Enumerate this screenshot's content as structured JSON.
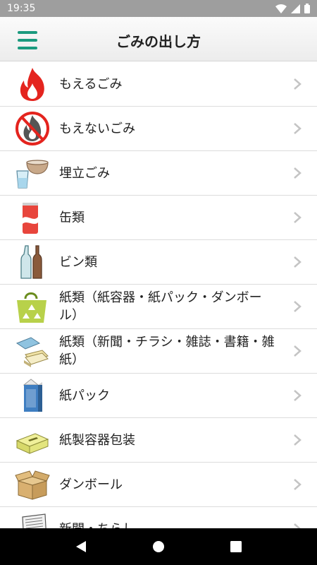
{
  "status": {
    "time": "19:35"
  },
  "header": {
    "title": "ごみの出し方"
  },
  "items": [
    {
      "label": "もえるごみ",
      "icon": "fire-icon"
    },
    {
      "label": "もえないごみ",
      "icon": "no-fire-icon"
    },
    {
      "label": "埋立ごみ",
      "icon": "bowl-glass-icon"
    },
    {
      "label": "缶類",
      "icon": "can-icon"
    },
    {
      "label": "ビン類",
      "icon": "bottles-icon"
    },
    {
      "label": "紙類（紙容器・紙パック・ダンボール）",
      "icon": "recycle-bag-icon"
    },
    {
      "label": "紙類（新聞・チラシ・雑誌・書籍・雑紙）",
      "icon": "newspaper-stack-icon"
    },
    {
      "label": "紙パック",
      "icon": "milk-carton-icon"
    },
    {
      "label": "紙製容器包装",
      "icon": "tissue-box-icon"
    },
    {
      "label": "ダンボール",
      "icon": "cardboard-box-icon"
    },
    {
      "label": "新聞・ちらし",
      "icon": "newspaper-icon"
    }
  ],
  "colors": {
    "accent": "#1b9a7e",
    "status_bar": "#9e9e9e",
    "fire": "#e4241e"
  }
}
